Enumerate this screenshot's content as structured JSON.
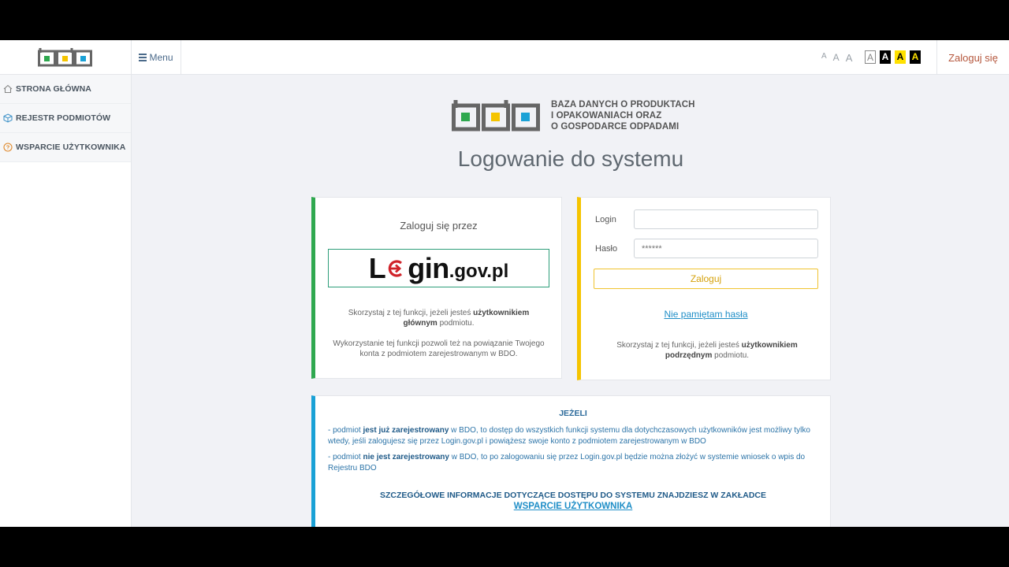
{
  "header": {
    "menu_label": "Menu",
    "font_sizes": [
      "A",
      "A",
      "A"
    ],
    "contrast_options": [
      "A",
      "A",
      "A",
      "A"
    ],
    "login_label": "Zaloguj się"
  },
  "sidebar": {
    "items": [
      {
        "label": "STRONA GŁÓWNA",
        "icon": "home-icon"
      },
      {
        "label": "REJESTR PODMIOTÓW",
        "icon": "cube-icon"
      },
      {
        "label": "WSPARCIE UŻYTKOWNIKA",
        "icon": "help-icon"
      }
    ]
  },
  "brand": {
    "line1": "BAZA DANYCH O PRODUKTACH",
    "line2": "I OPAKOWANIACH ORAZ",
    "line3": "O GOSPODARCE ODPADAMI"
  },
  "page_title": "Logowanie do systemu",
  "login_gov": {
    "heading": "Zaloguj się przez",
    "logo_main_pre": "L",
    "logo_main_post": "gin",
    "logo_suffix": ".gov.pl",
    "note1_pre": "Skorzystaj z tej funkcji, jeżeli jesteś ",
    "note1_bold": "użytkownikiem głównym",
    "note1_post": " podmiotu.",
    "note2": "Wykorzystanie tej funkcji pozwoli też na powiązanie Twojego konta z podmiotem zarejestrowanym w BDO."
  },
  "login_form": {
    "login_label": "Login",
    "login_value": "",
    "password_label": "Hasło",
    "password_placeholder": "******",
    "submit_label": "Zaloguj",
    "forgot_label": "Nie pamiętam hasła",
    "note_pre": "Skorzystaj z tej funkcji, jeżeli jesteś ",
    "note_bold": "użytkownikiem podrzędnym",
    "note_post": " podmiotu."
  },
  "info": {
    "title": "JEŻELI",
    "line1_pre": "- podmiot ",
    "line1_bold": "jest już zarejestrowany",
    "line1_post": " w BDO, to dostęp do wszystkich funkcji systemu dla dotychczasowych użytkowników jest możliwy tylko wtedy, jeśli zalogujesz się przez Login.gov.pl i powiążesz swoje konto z podmiotem zarejestrowanym w BDO",
    "line2_pre": "- podmiot ",
    "line2_bold": "nie jest zarejestrowany",
    "line2_post": " w BDO, to po zalogowaniu się przez Login.gov.pl będzie można złożyć w systemie wniosek o wpis do Rejestru BDO",
    "footer": "SZCZEGÓŁOWE INFORMACJE DOTYCZĄCE DOSTĘPU DO SYSTEMU ZNAJDZIESZ W ZAKŁADCE",
    "link": "WSPARCIE UŻYTKOWNIKA"
  },
  "colors": {
    "green": "#2fa84f",
    "yellow": "#f5c400",
    "blue": "#1aa1d6",
    "login_link": "#b5573d"
  }
}
